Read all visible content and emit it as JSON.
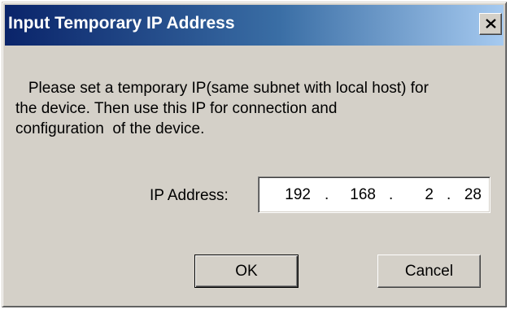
{
  "window": {
    "title": "Input Temporary IP Address",
    "close_icon": "close-icon"
  },
  "message": "   Please set a temporary IP(same subnet with local host) for\nthe device. Then use this IP for connection and\nconfiguration  of the device.",
  "ip_address": {
    "label": "IP Address:",
    "octets": [
      "192",
      "168",
      "2",
      "28"
    ],
    "separator": "."
  },
  "buttons": {
    "ok_label": "OK",
    "cancel_label": "Cancel"
  },
  "colors": {
    "titlebar_start": "#0a246a",
    "titlebar_end": "#a6caf0",
    "dialog_face": "#d4d0c8"
  }
}
